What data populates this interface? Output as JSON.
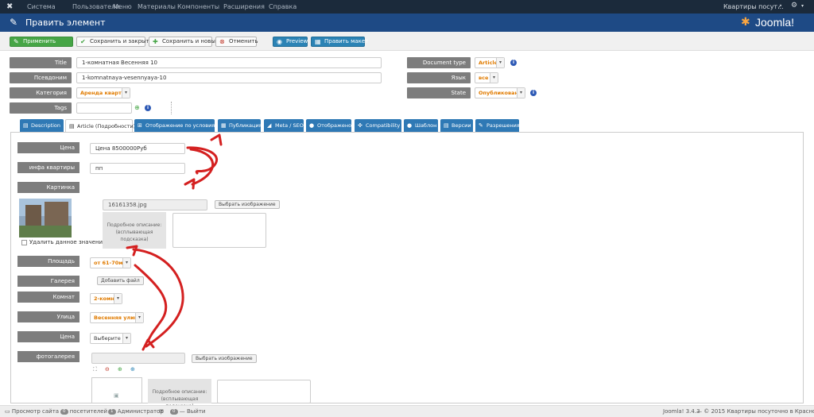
{
  "topnav": {
    "items": [
      "Система",
      "Пользователи",
      "Меню",
      "Материалы",
      "Компоненты",
      "Расширения",
      "Справка"
    ],
    "site_link": "Квартиры посут...",
    "gear": "⚙"
  },
  "header": {
    "title": "Править элемент",
    "brand": "Joomla!"
  },
  "toolbar": {
    "apply": "Применить",
    "save_close": "Сохранить и закрыть",
    "save_new": "Сохранить и новый",
    "cancel": "Отменить",
    "preview": "Preview",
    "edit_layout": "Править макет"
  },
  "form": {
    "title_label": "Title",
    "title_value": "1-комнатная Весенняя 10",
    "alias_label": "Псевдоним",
    "alias_value": "1-komnatnaya-vesennyaya-10",
    "category_label": "Категория",
    "category_value": "Аренда квартир",
    "tags_label": "Tags",
    "doctype_label": "Document type",
    "doctype_value": "Article",
    "lang_label": "Язык",
    "lang_value": "все",
    "state_label": "State",
    "state_value": "Опубликовано"
  },
  "tabs": [
    "Description",
    "Article (Подробности)",
    "Отображение по условиям",
    "Публикация",
    "Meta / SEO",
    "Отображено",
    "Compatibility",
    "Шаблон",
    "Версии",
    "Разрешения"
  ],
  "fields": {
    "price_label": "Цена",
    "price_value": "Цена 8500000Руб",
    "info_label": "инфа квартиры",
    "info_value": "пп",
    "photo_label": "Картинка квартиры",
    "image_name": "16161358.jpg",
    "choose_image": "Выбрать изображение",
    "desc_line1": "Подробное описание:",
    "desc_line2": "(всплывающая подсказка)",
    "delete_value": "Удалить данное значение",
    "area_label": "Площадь",
    "area_value": "от 61-70м2",
    "gallery_label": "Галерея",
    "add_file": "Добавить файл",
    "rooms_label": "Комнат",
    "rooms_value": "2-комн",
    "street_label": "Улица",
    "street_value": "Весенняя улица",
    "cena_label": "Цена",
    "cena_value": "Выберите",
    "photogallery_label": "фотогалерея",
    "choose_image2": "Выбрать изображение",
    "desc2_line1": "Подробное описание:",
    "desc2_line2": "(всплывающая подсказка)"
  },
  "footer": {
    "view_site": "Просмотр сайта",
    "visitors_count": "0",
    "visitors": "посетителей",
    "admins_count": "1",
    "admins": "Администратор",
    "messages_count": "0",
    "logout": "Выйти",
    "version": "Joomla! 3.4.3",
    "copyright": "— © 2015 Квартиры посуточно в Красноярске"
  },
  "colors": {
    "nav": "#1b2a3b",
    "header": "#1e4a85",
    "apply": "#46a546",
    "tab": "#2f79b5",
    "arrow": "#d42020"
  }
}
